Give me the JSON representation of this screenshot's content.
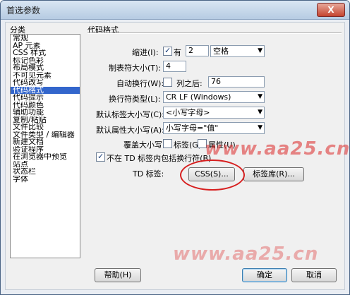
{
  "window": {
    "title": "首选参数",
    "close_glyph": "X"
  },
  "categories": {
    "heading": "分类",
    "items": [
      "常规",
      "AP 元素",
      "CSS 样式",
      "标记色彩",
      "布局模式",
      "不可见元素",
      "代码改写",
      "代码格式",
      "代码提示",
      "代码颜色",
      "辅助功能",
      "复制/粘贴",
      "文件比较",
      "文件类型 / 编辑器",
      "新建文档",
      "验证程序",
      "在浏览器中预览",
      "站点",
      "状态栏",
      "字体"
    ],
    "selected_index": 7
  },
  "section": {
    "title": "代码格式",
    "indent_label": "缩进(I):",
    "indent_check_label": "有",
    "indent_value": "2",
    "indent_type": "空格",
    "tab_size_label": "制表符大小(T):",
    "tab_size_value": "4",
    "autowrap_label": "自动换行(W):",
    "autowrap_after_label": "列之后:",
    "autowrap_value": "76",
    "linebreak_label": "换行符类型(L):",
    "linebreak_value": "CR LF (Windows)",
    "tag_case_label": "默认标签大小写(C):",
    "tag_case_value": "<小写字母>",
    "attr_case_label": "默认属性大小写(A):",
    "attr_case_value": "小写字母=\"值\"",
    "override_label": "覆盖大小写:",
    "override_tag_label": "标签(G)",
    "override_attr_label": "属性(U)",
    "td_nowrap_label": "不在 TD 标签内包括换行符(B)",
    "td_label": "TD 标签:",
    "css_button": "CSS(S)...",
    "tag_library_button": "标签库(R)..."
  },
  "footer": {
    "help_button": "帮助(H)",
    "ok_button": "确定",
    "cancel_button": "取消"
  },
  "watermark": "www.aa25.cn"
}
